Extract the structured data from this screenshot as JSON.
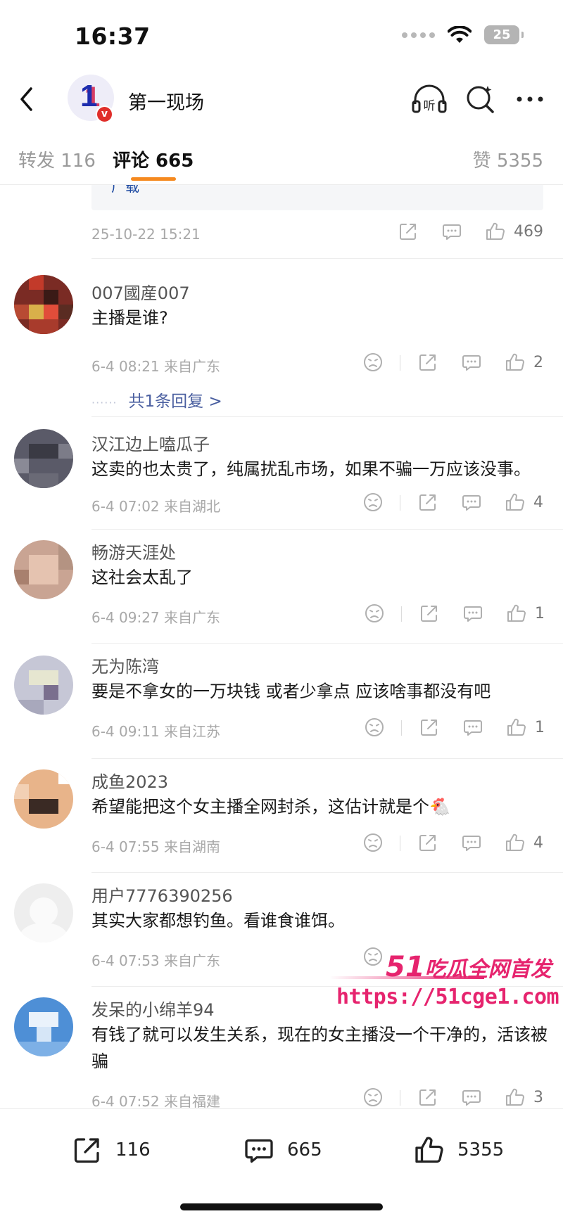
{
  "status_bar": {
    "time": "16:37",
    "battery": "25"
  },
  "header": {
    "title": "第一现场",
    "avatar_glyph": "1",
    "verified_badge": "v"
  },
  "tabs": {
    "repost_label": "转发 116",
    "comment_label": "评论 665",
    "like_label": "赞 5355",
    "accent_color": "#f5891f"
  },
  "post": {
    "link_card_text": "广载",
    "timestamp": "25-10-22 15:21",
    "like_count": "469"
  },
  "comments": [
    {
      "name": "007國産007",
      "text": "主播是谁?",
      "meta": "6-4 08:21 来自广东",
      "likes": "2",
      "reply_link": "共1条回复 >"
    },
    {
      "name": "汉江边上嗑瓜子",
      "text": "这卖的也太贵了，纯属扰乱市场，如果不骗一万应该没事。",
      "meta": "6-4 07:02 来自湖北",
      "likes": "4"
    },
    {
      "name": "畅游天涯处",
      "text": "这社会太乱了",
      "meta": "6-4 09:27 来自广东",
      "likes": "1"
    },
    {
      "name": "无为陈湾",
      "text": "要是不拿女的一万块钱 或者少拿点 应该啥事都没有吧",
      "meta": "6-4 09:11 来自江苏",
      "likes": "1"
    },
    {
      "name": "成鱼2023",
      "text": "希望能把这个女主播全网封杀，这估计就是个",
      "emoji": "🐔",
      "meta": "6-4 07:55 来自湖南",
      "likes": "4"
    },
    {
      "name": "用户7776390256",
      "text": "其实大家都想钓鱼。看谁食谁饵。",
      "meta": "6-4 07:53 来自广东",
      "likes": ""
    },
    {
      "name": "发呆的小绵羊94",
      "text": "有钱了就可以发生关系，现在的女主播没一个干净的，活该被骗",
      "meta": "6-4 07:52 来自福建",
      "likes": "3"
    }
  ],
  "watermark": {
    "line1_num": "51",
    "line1_text": "吃瓜全网首发",
    "url": "https://51cge1.com",
    "color": "#e6246e"
  },
  "bottom_bar": {
    "repost_count": "116",
    "comment_count": "665",
    "like_count": "5355"
  }
}
